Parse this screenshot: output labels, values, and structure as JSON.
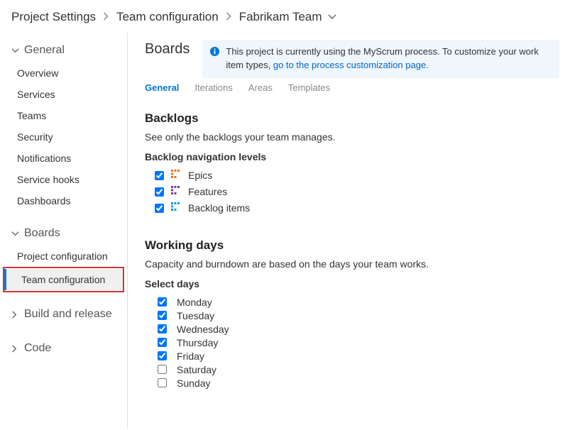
{
  "breadcrumb": {
    "seg1": "Project Settings",
    "seg2": "Team configuration",
    "seg3": "Fabrikam Team"
  },
  "sidebar": {
    "groups": [
      {
        "label": "General",
        "expanded": true,
        "items": [
          "Overview",
          "Services",
          "Teams",
          "Security",
          "Notifications",
          "Service hooks",
          "Dashboards"
        ]
      },
      {
        "label": "Boards",
        "expanded": true,
        "items": [
          "Project configuration",
          "Team configuration"
        ]
      },
      {
        "label": "Build and release",
        "expanded": false,
        "items": []
      },
      {
        "label": "Code",
        "expanded": false,
        "items": []
      }
    ]
  },
  "main": {
    "title": "Boards",
    "banner": {
      "text": "This project is currently using the MyScrum process. To customize your work item types, ",
      "link": "go to the process customization page."
    },
    "tabs": [
      "General",
      "Iterations",
      "Areas",
      "Templates"
    ],
    "backlogs": {
      "title": "Backlogs",
      "desc": "See only the backlogs your team manages.",
      "subtitle": "Backlog navigation levels",
      "items": [
        "Epics",
        "Features",
        "Backlog items"
      ]
    },
    "workingdays": {
      "title": "Working days",
      "desc": "Capacity and burndown are based on the days your team works.",
      "subtitle": "Select days",
      "days": [
        {
          "label": "Monday",
          "checked": true
        },
        {
          "label": "Tuesday",
          "checked": true
        },
        {
          "label": "Wednesday",
          "checked": true
        },
        {
          "label": "Thursday",
          "checked": true
        },
        {
          "label": "Friday",
          "checked": true
        },
        {
          "label": "Saturday",
          "checked": false
        },
        {
          "label": "Sunday",
          "checked": false
        }
      ]
    }
  }
}
